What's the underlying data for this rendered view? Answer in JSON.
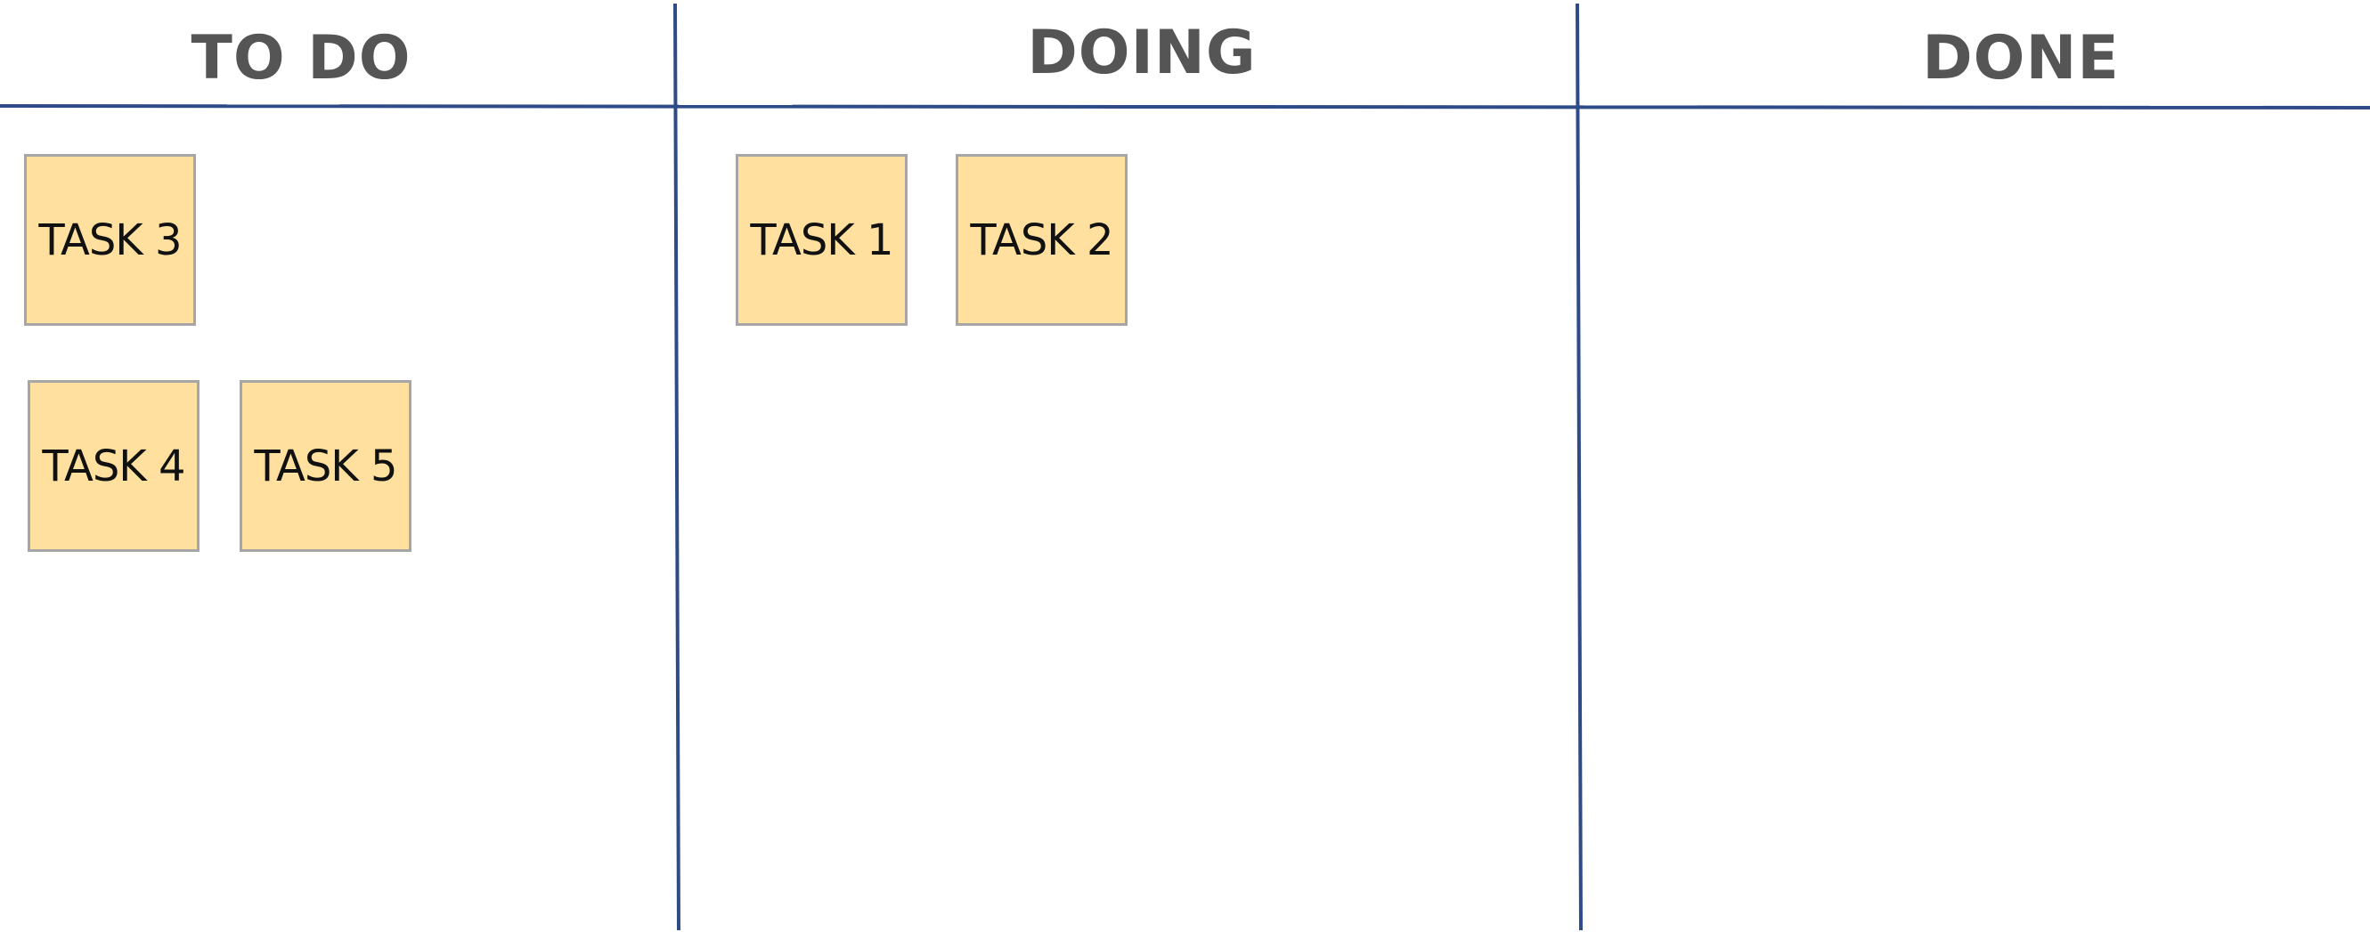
{
  "board": {
    "line_color": "#2f4b87",
    "note_color": "#ffe09f",
    "columns": [
      {
        "title": "TO DO",
        "tasks": [
          "TASK 3",
          "TASK 4",
          "TASK 5"
        ]
      },
      {
        "title": "DOING",
        "tasks": [
          "TASK 1",
          "TASK 2"
        ]
      },
      {
        "title": "DONE",
        "tasks": []
      }
    ]
  }
}
